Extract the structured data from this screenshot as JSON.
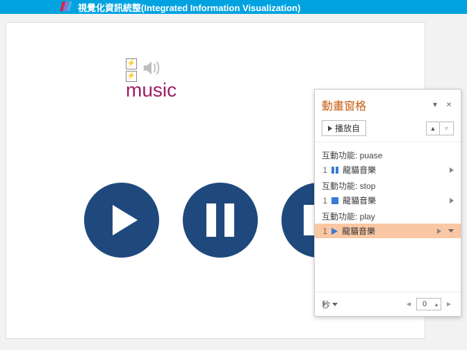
{
  "titlebar": {
    "text": "視覺化資訊統整(Integrated Information Visualization)"
  },
  "slide": {
    "music_label": "music",
    "buttons": {
      "play": "play",
      "pause": "pause",
      "stop": "stop"
    }
  },
  "pane": {
    "title": "動畫窗格",
    "play_from": "播放自",
    "groups": [
      {
        "header": "互動功能: puase",
        "type": "pause",
        "index": "1",
        "name": "龍貓音樂",
        "selected": false
      },
      {
        "header": "互動功能: stop",
        "type": "stop",
        "index": "1",
        "name": "龍貓音樂",
        "selected": false
      },
      {
        "header": "互動功能: play",
        "type": "play",
        "index": "1",
        "name": "龍貓音樂",
        "selected": true
      }
    ],
    "footer": {
      "seconds_label": "秒",
      "spinner_value": "0"
    }
  }
}
